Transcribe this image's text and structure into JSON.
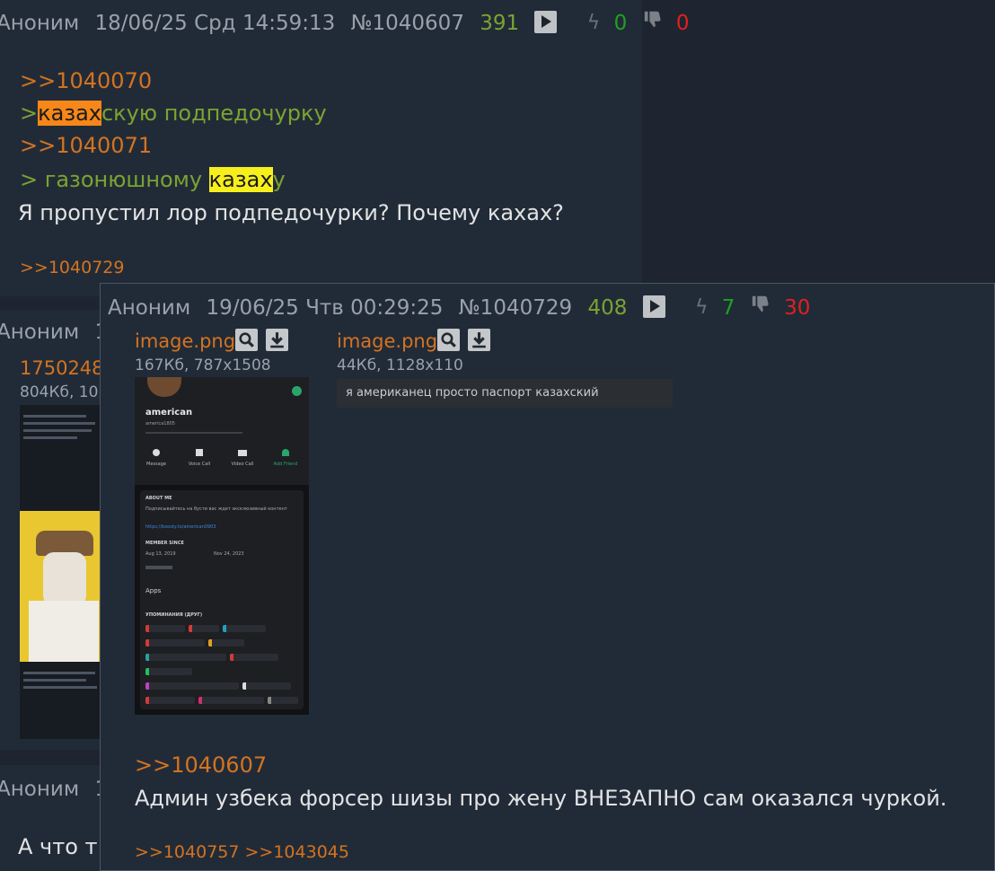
{
  "post1": {
    "author": "Аноним",
    "date": "18/06/25 Срд 14:59:13",
    "number": "№1040607",
    "ordinal": "391",
    "likes": "0",
    "dislikes": "0",
    "reply_link_1": ">>1040070",
    "q1_prefix": ">",
    "q1_highlight": "казах",
    "q1_rest": "скую подпедочурку",
    "reply_link_2": ">>1040071",
    "q2_prefix": "> газонюшному ",
    "q2_highlight": "казах",
    "q2_rest": "у",
    "text": "Я пропустил лор подпедочурки? Почему каxах?",
    "replies": ">>1040729"
  },
  "post2": {
    "author": "Аноним",
    "date_partial": "18",
    "file_partial": "17502481",
    "info_partial": "804Кб, 10"
  },
  "post3": {
    "author": "Аноним",
    "date_partial": "18",
    "text_partial": "А что т"
  },
  "popup": {
    "author": "Аноним",
    "date": "19/06/25 Чтв 00:29:25",
    "number": "№1040729",
    "ordinal": "408",
    "likes": "7",
    "dislikes": "30",
    "files": [
      {
        "name": "image.png",
        "info": "167Кб, 787x1508"
      },
      {
        "name": "image.png",
        "info": "44Кб, 1128x110"
      }
    ],
    "thumb1": {
      "username": "american",
      "handle": "america1805",
      "actions": [
        "Message",
        "Voice Call",
        "Video Call",
        "Add Friend"
      ],
      "about_heading": "ABOUT ME",
      "about_text": "Подписывайтесь на бусти вас ждет эксклюзивный контент",
      "about_link": "https://boosty.to/american0903",
      "member_since": "MEMBER SINCE",
      "since_1": "Aug 13, 2019",
      "since_2": "Nov 24, 2023",
      "apps_label": "Apps",
      "mutual_label": "УПОМИНАНИЯ (ДРУГ)"
    },
    "thumb2_text": "я американец просто паспорт казахский",
    "reply_link": ">>1040607",
    "text": "Админ узбека форсер шизы про жену ВНЕЗАПНО сам оказался чуркой.",
    "replies": ">>1040757 >>1043045"
  },
  "colors": {
    "background": "#1e2530",
    "post_bg": "#212b38",
    "link": "#d5731f",
    "quote": "#7ba331",
    "likes": "#20a020",
    "dislikes": "#e02020"
  }
}
